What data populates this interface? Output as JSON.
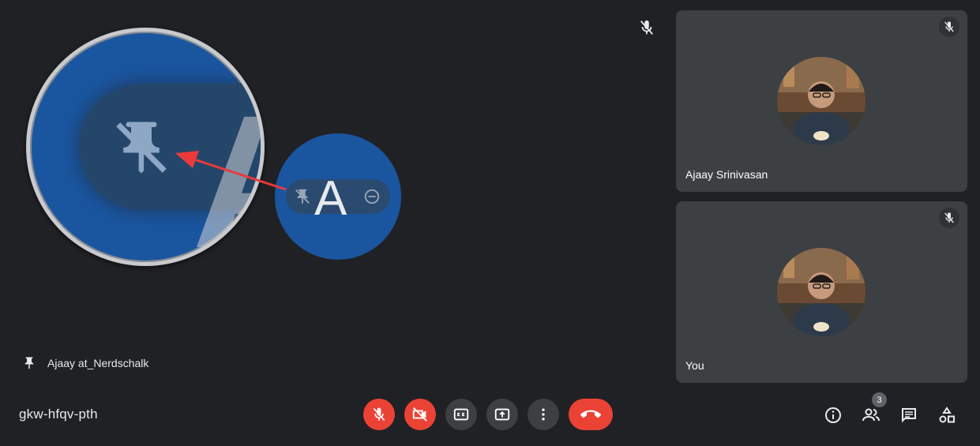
{
  "stage": {
    "pinned_name": "Ajaay at_Nerdschalk",
    "zoom_letter": "A",
    "annotation_color": "#ea3a3a"
  },
  "participants": [
    {
      "name": "Ajaay Srinivasan",
      "muted": true
    },
    {
      "name": "You",
      "muted": true
    }
  ],
  "bottom_bar": {
    "meeting_code": "gkw-hfqv-pth",
    "participant_count": "3",
    "controls": [
      "mic-off-icon",
      "camera-off-icon",
      "captions-icon",
      "present-icon",
      "more-vert-icon",
      "end-call-icon"
    ],
    "right_icons": [
      "info-icon",
      "people-icon",
      "chat-icon",
      "activities-icon"
    ]
  },
  "colors": {
    "background": "#202124",
    "tile": "#3c4043",
    "danger": "#ea4335",
    "zoom_blue": "#1a56a0"
  }
}
